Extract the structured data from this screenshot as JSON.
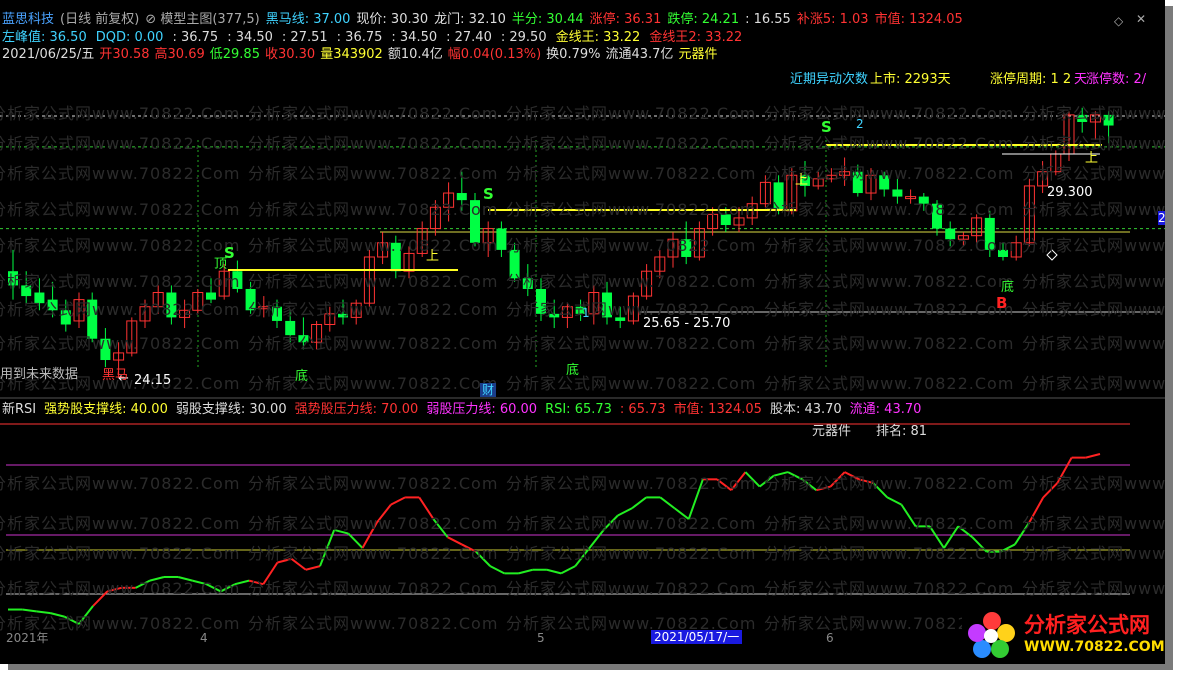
{
  "window_title": "分析家主图截图",
  "header": {
    "line1": [
      {
        "text": "蓝思科技",
        "color": "#4aa3ff"
      },
      {
        "text": "(日线 前复权)",
        "color": "#aaaaaa"
      },
      {
        "text": "⊘ 模型主图(377,5)",
        "color": "#aaaaaa"
      },
      {
        "text": "黑马线: 37.00",
        "color": "#3fd3ff"
      },
      {
        "text": "现价: 30.30",
        "color": "#dddddd"
      },
      {
        "text": "龙门: 32.10",
        "color": "#dddddd"
      },
      {
        "text": "半分: 30.44",
        "color": "#33ff33"
      },
      {
        "text": "涨停: 36.31",
        "color": "#ff3333"
      },
      {
        "text": "跌停: 24.21",
        "color": "#33ff33"
      },
      {
        "text": ": 16.55",
        "color": "#dddddd"
      },
      {
        "text": "补涨5: 1.03",
        "color": "#ff3333"
      },
      {
        "text": "市值: 1324.05",
        "color": "#ff3333"
      }
    ],
    "line2": [
      {
        "text": "左峰值: 36.50",
        "color": "#3fd3ff"
      },
      {
        "text": "DQD: 0.00",
        "color": "#3fd3ff"
      },
      {
        "text": ": 36.75",
        "color": "#dddddd"
      },
      {
        "text": ": 34.50",
        "color": "#dddddd"
      },
      {
        "text": ": 27.51",
        "color": "#dddddd"
      },
      {
        "text": ": 36.75",
        "color": "#dddddd"
      },
      {
        "text": ": 34.50",
        "color": "#dddddd"
      },
      {
        "text": ": 27.40",
        "color": "#dddddd"
      },
      {
        "text": ": 29.50",
        "color": "#dddddd"
      },
      {
        "text": "金线王: 33.22",
        "color": "#ffff33"
      },
      {
        "text": "金线王2: 33.22",
        "color": "#ff3333"
      }
    ],
    "line3": [
      {
        "text": "2021/06/25/五",
        "color": "#dddddd"
      },
      {
        "text": "开30.58",
        "color": "#ff3333"
      },
      {
        "text": "高30.69",
        "color": "#ff3333"
      },
      {
        "text": "低29.85",
        "color": "#33ff33"
      },
      {
        "text": "收30.30",
        "color": "#ff3333"
      },
      {
        "text": "量343902",
        "color": "#ffff33"
      },
      {
        "text": "额10.4亿",
        "color": "#dddddd"
      },
      {
        "text": "幅0.04(0.13%)",
        "color": "#ff3333"
      },
      {
        "text": "换0.79%",
        "color": "#dddddd"
      },
      {
        "text": "流通43.7亿",
        "color": "#dddddd"
      },
      {
        "text": "元器件",
        "color": "#ffff33"
      }
    ]
  },
  "main_chart_labels": {
    "recent_move": "近期异动次数",
    "listing": "上市: 2293天",
    "limit_cycle": "涨停周期: 1 2",
    "days_count": "天",
    "limit_count": "涨停数: 2/",
    "top_marker": "顶",
    "bottom_marker": "底",
    "shang_marker": "上",
    "s_marker": "S",
    "b_marker": "B",
    "number_1": "1",
    "number_2": "2",
    "price_high": "29.300",
    "range_label": "25.65 - 25.70",
    "low_price": "24.15",
    "left_note": "用到未来数据",
    "black_label": "黑马",
    "cai_badge": "财",
    "right_edge": "2"
  },
  "rsi_header": [
    {
      "text": "新RSI",
      "color": "#dddddd"
    },
    {
      "text": "强势股支撑线: 40.00",
      "color": "#ffff33"
    },
    {
      "text": "弱股支撑线: 30.00",
      "color": "#dddddd"
    },
    {
      "text": "强势股压力线: 70.00",
      "color": "#ff3333"
    },
    {
      "text": "弱股压力线: 60.00",
      "color": "#ff33ff"
    },
    {
      "text": "RSI: 65.73",
      "color": "#33ff33"
    },
    {
      "text": ": 65.73",
      "color": "#ff3333"
    },
    {
      "text": "市值: 1324.05",
      "color": "#ff3333"
    },
    {
      "text": "股本: 43.70",
      "color": "#dddddd"
    },
    {
      "text": "流通: 43.70",
      "color": "#ff33ff"
    }
  ],
  "rsi_sub": {
    "sector": "元器件",
    "rank": "排名: 81"
  },
  "x_axis": {
    "year": "2021年",
    "m4": "4",
    "m5": "5",
    "m6": "6",
    "cursor_date": "2021/05/17/一"
  },
  "watermark": "分析家公式网www.70822.Com",
  "logo": {
    "name": "分析家公式网",
    "url": "WWW.70822.COM"
  },
  "colors": {
    "up": "#ff3333",
    "down": "#00ff44",
    "bg": "#000000",
    "gold": "#ffff22"
  },
  "chart_data": {
    "type": "candlestick",
    "candles": [
      [
        26.2,
        26.8,
        25.4,
        25.8
      ],
      [
        25.8,
        26.2,
        25.3,
        25.5
      ],
      [
        25.6,
        26.0,
        25.1,
        25.3
      ],
      [
        25.4,
        25.9,
        24.9,
        25.1
      ],
      [
        25.1,
        25.4,
        24.5,
        24.7
      ],
      [
        24.8,
        25.6,
        24.6,
        25.4
      ],
      [
        25.4,
        25.6,
        24.2,
        24.3
      ],
      [
        24.3,
        24.6,
        23.5,
        23.7
      ],
      [
        23.7,
        24.2,
        23.2,
        23.9
      ],
      [
        23.9,
        24.9,
        23.8,
        24.8
      ],
      [
        24.8,
        25.4,
        24.6,
        25.2
      ],
      [
        25.2,
        25.8,
        25.0,
        25.6
      ],
      [
        25.6,
        25.8,
        24.7,
        24.9
      ],
      [
        24.9,
        25.4,
        24.6,
        25.1
      ],
      [
        25.1,
        25.7,
        25.0,
        25.6
      ],
      [
        25.6,
        26.0,
        25.3,
        25.4
      ],
      [
        25.5,
        26.4,
        25.4,
        26.2
      ],
      [
        26.2,
        26.5,
        25.6,
        25.7
      ],
      [
        25.7,
        25.9,
        25.0,
        25.1
      ],
      [
        25.2,
        25.5,
        24.9,
        25.2
      ],
      [
        25.2,
        25.4,
        24.6,
        24.8
      ],
      [
        24.8,
        25.1,
        24.2,
        24.4
      ],
      [
        24.4,
        24.9,
        24.0,
        24.2
      ],
      [
        24.2,
        24.8,
        24.0,
        24.7
      ],
      [
        24.7,
        25.2,
        24.5,
        25.0
      ],
      [
        25.0,
        25.4,
        24.7,
        24.9
      ],
      [
        24.9,
        25.4,
        24.7,
        25.3
      ],
      [
        25.3,
        26.8,
        25.2,
        26.6
      ],
      [
        26.6,
        27.3,
        26.4,
        27.0
      ],
      [
        27.0,
        27.2,
        26.0,
        26.2
      ],
      [
        26.2,
        26.9,
        26.0,
        26.7
      ],
      [
        26.7,
        27.6,
        26.6,
        27.4
      ],
      [
        27.4,
        28.2,
        27.2,
        28.0
      ],
      [
        28.0,
        28.7,
        27.6,
        28.4
      ],
      [
        28.4,
        29.0,
        27.9,
        28.2
      ],
      [
        28.2,
        28.4,
        26.9,
        27.0
      ],
      [
        27.0,
        27.6,
        26.6,
        27.4
      ],
      [
        27.4,
        27.6,
        26.6,
        26.8
      ],
      [
        26.8,
        27.0,
        25.9,
        26.0
      ],
      [
        26.0,
        26.4,
        25.5,
        25.7
      ],
      [
        25.7,
        26.0,
        24.8,
        25.0
      ],
      [
        25.0,
        25.4,
        24.6,
        24.9
      ],
      [
        24.9,
        25.3,
        24.6,
        25.2
      ],
      [
        25.2,
        25.4,
        24.8,
        25.0
      ],
      [
        25.0,
        25.8,
        24.7,
        25.6
      ],
      [
        25.6,
        25.9,
        24.7,
        24.9
      ],
      [
        24.9,
        25.2,
        24.6,
        24.8
      ],
      [
        24.8,
        25.6,
        24.7,
        25.5
      ],
      [
        25.5,
        26.4,
        25.4,
        26.2
      ],
      [
        26.2,
        26.8,
        26.0,
        26.6
      ],
      [
        26.6,
        27.3,
        26.3,
        27.1
      ],
      [
        27.1,
        27.6,
        26.4,
        26.6
      ],
      [
        26.6,
        27.6,
        26.5,
        27.4
      ],
      [
        27.4,
        28.0,
        27.2,
        27.8
      ],
      [
        27.8,
        28.0,
        27.3,
        27.5
      ],
      [
        27.5,
        28.0,
        27.3,
        27.7
      ],
      [
        27.7,
        28.3,
        27.5,
        28.1
      ],
      [
        28.1,
        28.9,
        28.0,
        28.7
      ],
      [
        28.7,
        28.9,
        27.8,
        27.9
      ],
      [
        27.9,
        29.1,
        27.8,
        28.9
      ],
      [
        28.9,
        29.3,
        28.3,
        28.6
      ],
      [
        28.6,
        29.0,
        28.5,
        28.8
      ],
      [
        28.8,
        29.1,
        28.7,
        28.9
      ],
      [
        28.9,
        29.4,
        28.6,
        29.0
      ],
      [
        29.0,
        29.2,
        28.3,
        28.4
      ],
      [
        28.4,
        29.1,
        28.2,
        28.9
      ],
      [
        28.9,
        29.0,
        28.3,
        28.5
      ],
      [
        28.5,
        28.8,
        28.1,
        28.3
      ],
      [
        28.3,
        28.5,
        28.1,
        28.3
      ],
      [
        28.3,
        28.4,
        27.9,
        28.1
      ],
      [
        28.1,
        28.2,
        27.2,
        27.4
      ],
      [
        27.4,
        27.6,
        26.9,
        27.1
      ],
      [
        27.1,
        27.3,
        26.9,
        27.2
      ],
      [
        27.2,
        27.8,
        27.0,
        27.7
      ],
      [
        27.7,
        27.9,
        26.6,
        26.8
      ],
      [
        26.8,
        27.0,
        26.5,
        26.6
      ],
      [
        26.6,
        27.2,
        26.5,
        27.0
      ],
      [
        27.0,
        28.8,
        26.9,
        28.6
      ],
      [
        28.6,
        29.3,
        28.4,
        29.0
      ],
      [
        29.0,
        29.6,
        28.9,
        29.5
      ],
      [
        29.5,
        30.7,
        29.3,
        30.6
      ],
      [
        30.6,
        30.8,
        30.1,
        30.4
      ],
      [
        30.4,
        30.7,
        29.9,
        30.6
      ],
      [
        30.6,
        30.7,
        29.8,
        30.3
      ]
    ],
    "levels": {
      "upper_dash": 29.7,
      "lower_dash": 27.4,
      "white_line": 25.55
    },
    "rsi_values": [
      20,
      20,
      19.5,
      19,
      18,
      16,
      21,
      25,
      26,
      26,
      28,
      29,
      29,
      28,
      27,
      25,
      27,
      28,
      27,
      33,
      34,
      31,
      32,
      42,
      41,
      37,
      44,
      49,
      51,
      51,
      45,
      40,
      38,
      36,
      32,
      30,
      30,
      31,
      31,
      30,
      32,
      37,
      42,
      46,
      48,
      51,
      51,
      48,
      45,
      56,
      56,
      53,
      58,
      54,
      57,
      58,
      56,
      53,
      54,
      58,
      56,
      55,
      51,
      49,
      43,
      43,
      37,
      43,
      40,
      36,
      36,
      38,
      44,
      51,
      55,
      62,
      62,
      63
    ],
    "rsi_red_ranges": [
      [
        6,
        9
      ],
      [
        17,
        22
      ],
      [
        25,
        30
      ],
      [
        31,
        33
      ],
      [
        49,
        52
      ],
      [
        57,
        61
      ],
      [
        72,
        77
      ]
    ],
    "rsi_levels": {
      "strong_resist": 70,
      "weak_resist": 60,
      "strong_support": 40,
      "weak_support": 30
    }
  }
}
